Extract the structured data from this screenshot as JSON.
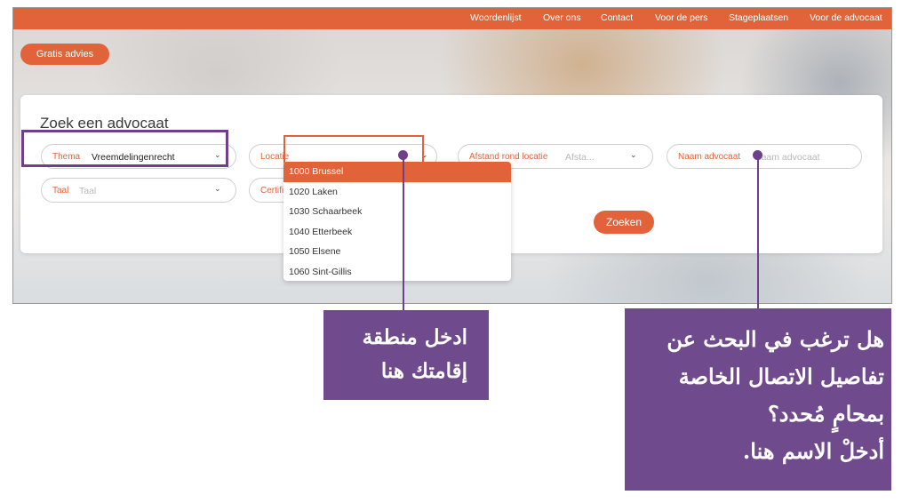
{
  "nav": {
    "items": [
      "Woordenlijst",
      "Over ons",
      "Contact",
      "Voor de pers",
      "Stageplaatsen",
      "Voor de advocaat"
    ]
  },
  "gratis_button": "Gratis advies",
  "search": {
    "title": "Zoek een advocaat",
    "thema": {
      "label": "Thema",
      "value": "Vreemdelingenrecht"
    },
    "locatie": {
      "label": "Locatie",
      "value": ""
    },
    "afstand": {
      "label": "Afstand rond locatie",
      "placeholder": "Afsta..."
    },
    "naam": {
      "label": "Naam advocaat",
      "placeholder": "Naam advocaat"
    },
    "taal": {
      "label": "Taal",
      "placeholder": "Taal"
    },
    "certificaat": {
      "label": "Certifica"
    },
    "submit": "Zoeken"
  },
  "locatie_options": [
    "1000 Brussel",
    "1020 Laken",
    "1030 Schaarbeek",
    "1040 Etterbeek",
    "1050 Elsene",
    "1060 Sint-Gillis"
  ],
  "callouts": {
    "location": {
      "lines": [
        "ادخل منطقة",
        "إقامتك هنا"
      ]
    },
    "name": {
      "lines": [
        "هل ترغب في البحث عن",
        "تفاصيل الاتصال الخاصة",
        "بمحامٍ مُحدد؟",
        "أدخلْ الاسم هنا."
      ]
    }
  },
  "colors": {
    "accent": "#e2633a",
    "callout": "#6f4a8c"
  },
  "icons": {
    "chevron": "chevron-down-icon"
  }
}
